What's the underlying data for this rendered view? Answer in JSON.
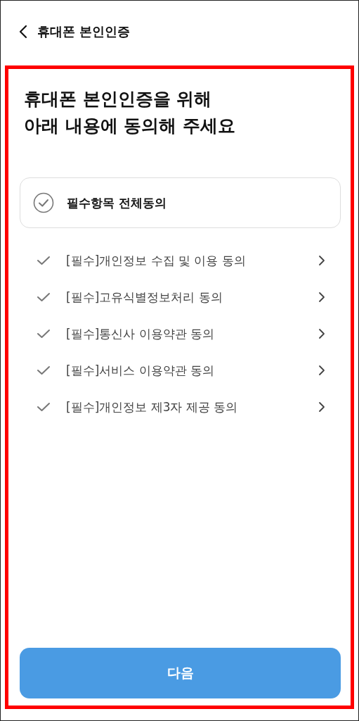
{
  "header": {
    "title": "휴대폰 본인인증"
  },
  "heading": [
    "휴대폰 본인인증을 위해",
    "아래 내용에 동의해 주세요"
  ],
  "agree_all": {
    "label": "필수항목 전체동의",
    "checked": false
  },
  "terms": [
    {
      "label": "[필수]개인정보 수집 및 이용 동의",
      "checked": false
    },
    {
      "label": "[필수]고유식별정보처리 동의",
      "checked": false
    },
    {
      "label": "[필수]통신사 이용약관 동의",
      "checked": false
    },
    {
      "label": "[필수]서비스 이용약관 동의",
      "checked": false
    },
    {
      "label": "[필수]개인정보 제3자 제공 동의",
      "checked": false
    }
  ],
  "next_button": {
    "label": "다음",
    "disabled": true
  }
}
